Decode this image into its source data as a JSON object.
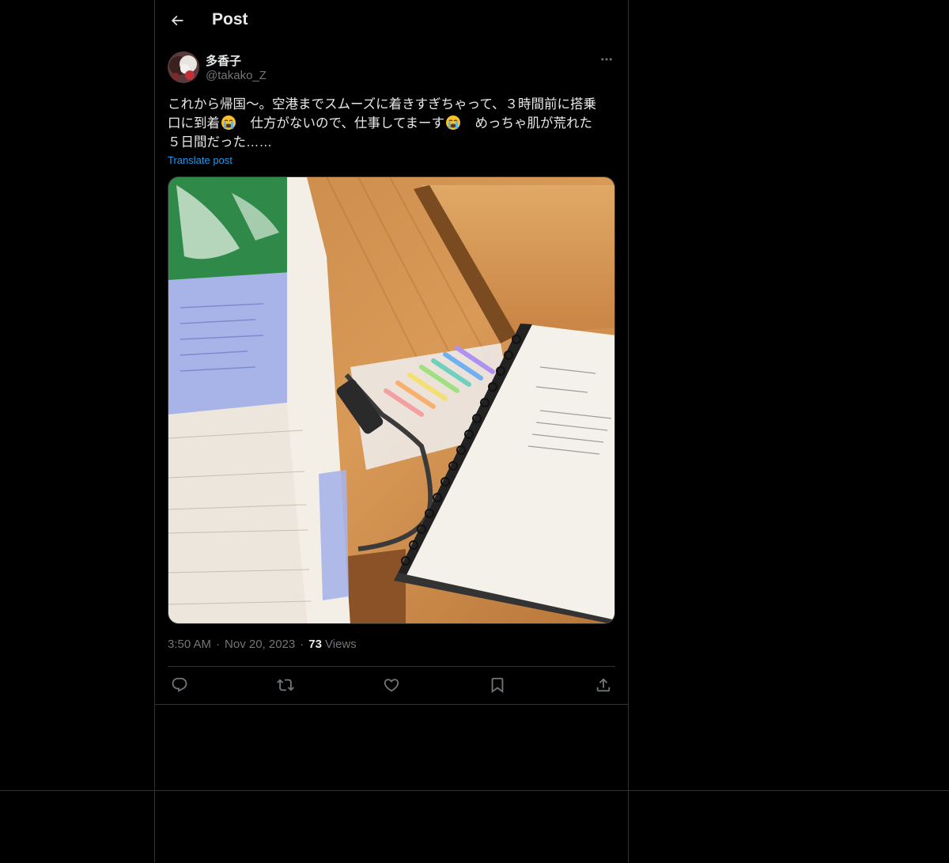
{
  "header": {
    "title": "Post",
    "back_icon": "arrow-left-icon"
  },
  "post": {
    "author_name": "多香子",
    "author_handle": "@takako_Z",
    "text_line1": "これから帰国〜。空港までスムーズに着きすぎちゃって、３時間前に搭乗",
    "text_line2a": "口に到着",
    "text_line2b": "　仕方がないので、仕事してまーす",
    "text_line2c": "　めっちゃ肌が荒れた",
    "text_line3": "５日間だった……",
    "emoji": "loudly-crying-face-icon",
    "translate_label": "Translate post",
    "time": "3:50 AM",
    "dot": "·",
    "date": "Nov 20, 2023",
    "views_count": "73",
    "views_label": "Views"
  },
  "actions": [
    {
      "name": "reply-icon"
    },
    {
      "name": "repost-icon"
    },
    {
      "name": "like-icon"
    },
    {
      "name": "bookmark-icon"
    },
    {
      "name": "share-icon"
    }
  ],
  "colors": {
    "background": "#000000",
    "text": "#e7e9ea",
    "secondary": "#71767b",
    "accent": "#1d9bf0",
    "border": "#2f3336"
  }
}
